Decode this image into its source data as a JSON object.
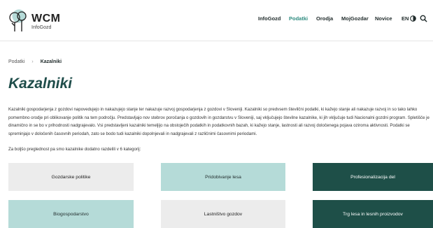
{
  "header": {
    "logo_word": "WCM",
    "logo_sub": "InfoGozd",
    "nav": [
      {
        "label": "InfoGozd",
        "active": false
      },
      {
        "label": "Podatki",
        "active": true
      },
      {
        "label": "Orodja",
        "active": false
      },
      {
        "label": "MojGozdar",
        "active": false
      },
      {
        "label": "Novice",
        "active": false
      }
    ],
    "lang": "EN",
    "icons": [
      "contrast-icon",
      "search-icon"
    ]
  },
  "breadcrumb": {
    "home": "Podatki",
    "current": "Kazalniki"
  },
  "page": {
    "title": "Kazalniki",
    "intro": "Kazalniki gospodarjenja z gozdovi napovedujejo in nakazujejo stanje ter nakazuje razvoj gospodarjenja z gozdovi v Sloveniji. Kazalniki so predvsem številčni podatki, ki kažejo stanje ali nakazuje razvoj in so tako lahko pomembno orodje pri oblikovanje politik na tem področju. Predstavljajo nov stebrov poročanja o gozdovih in gozdarstvu v Sloveniji, saj vključujejo številne kazalnike, ki jih vključuje tudi Nacionalni gozdni program. Spletišče je dinamično in se bo v prihodnosti nadgrajevalo. Vsi predstavljeni kazalniki temeljijo na obstoječih podatkih in podatkovnih bazah, ki kažejo stanje, lastnosti ali razvoj določenega pojava oziroma aktivnosti. Podatki se spreminjajo v določenih časovnih periodah, zato se bodo tudi kazalniki dopolnjevali in nadgrajevali z različnimi časovnimi periodami.",
    "lead": "Za boljšo preglednost pa smo kazalnike dodatno razdelili v 6 kategorij:"
  },
  "categories": [
    {
      "label": "Gozdarske politike",
      "style": "grey"
    },
    {
      "label": "Pridobivanje lesa",
      "style": "light"
    },
    {
      "label": "Profesionalizacija del",
      "style": "dark"
    },
    {
      "label": "Biogospodarstvo",
      "style": "light"
    },
    {
      "label": "Lastništvo gozdov",
      "style": "grey"
    },
    {
      "label": "Trg lesa in lesnih proizvodov",
      "style": "dark"
    }
  ],
  "colors": {
    "accent": "#2f8c80",
    "title": "#1f4d4a",
    "tile_grey": "#ececec",
    "tile_light": "#b5dbd8",
    "tile_dark": "#1e4f48"
  }
}
